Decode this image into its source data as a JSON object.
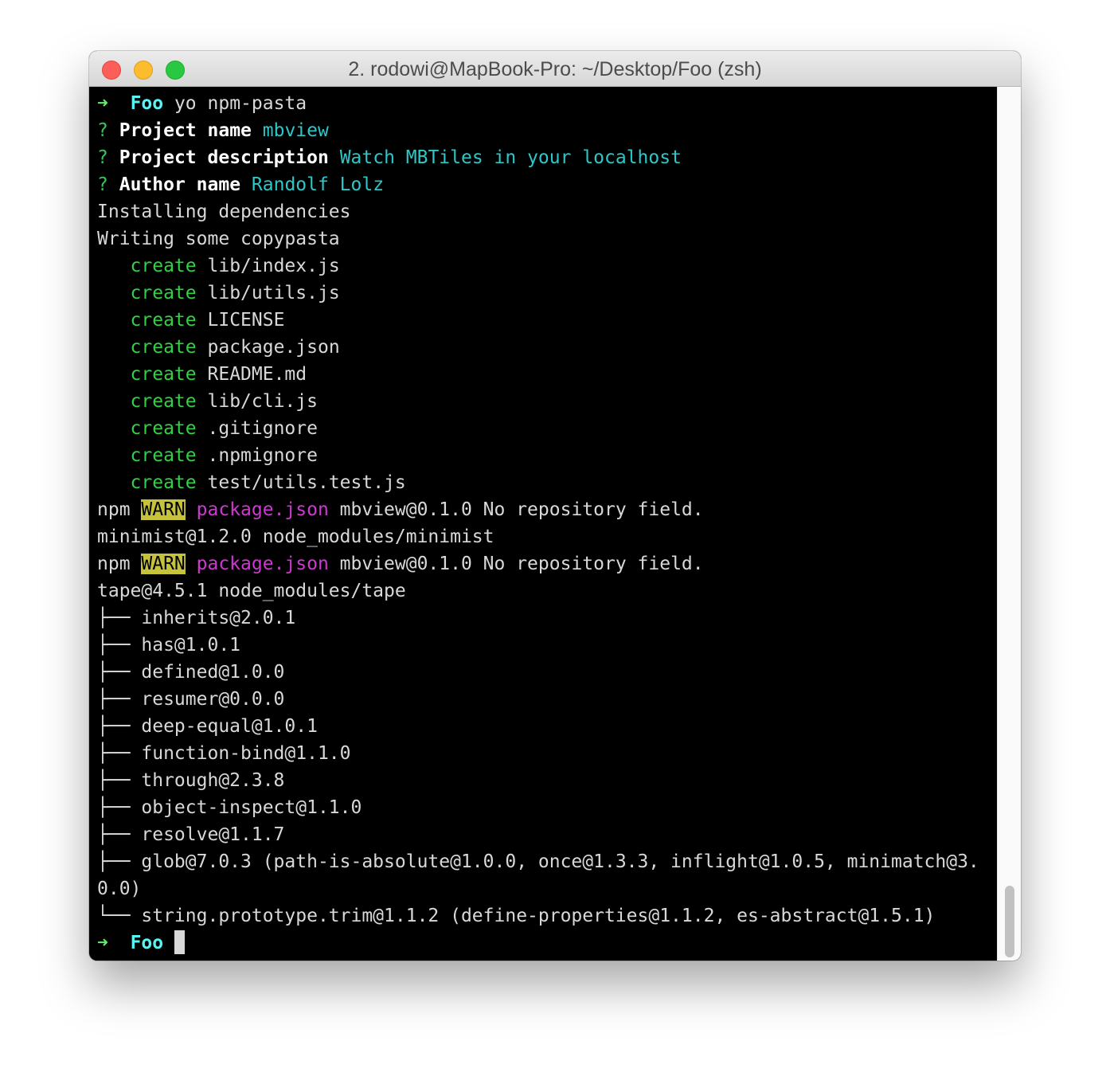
{
  "window": {
    "title": "2. rodowi@MapBook-Pro: ~/Desktop/Foo (zsh)",
    "controls": [
      "close",
      "minimize",
      "zoom"
    ]
  },
  "colors": {
    "prompt_arrow": "#5ef06a",
    "prompt_dir": "#58f4f4",
    "question_mark": "#33c55b",
    "answer": "#2dc7c9",
    "create": "#30d144",
    "warn_bg": "#c6c33b",
    "package_json": "#cf38d0",
    "text": "#d8d8d8",
    "background": "#000000"
  },
  "terminal": {
    "prompt": {
      "arrow": "➜",
      "dir": "Foo",
      "command": " yo npm-pasta"
    },
    "questions": [
      {
        "mark": "?",
        "label": "Project name",
        "answer": "mbview"
      },
      {
        "mark": "?",
        "label": "Project description",
        "answer": "Watch MBTiles in your localhost"
      },
      {
        "mark": "?",
        "label": "Author name",
        "answer": "Randolf Lolz"
      }
    ],
    "status_lines": [
      "Installing dependencies",
      "Writing some copypasta"
    ],
    "create_label": "create",
    "created_files": [
      "lib/index.js",
      "lib/utils.js",
      "LICENSE",
      "package.json",
      "README.md",
      "lib/cli.js",
      ".gitignore",
      ".npmignore",
      "test/utils.test.js"
    ],
    "npm_warn": {
      "prefix": "npm ",
      "warn": "WARN",
      "pkg": "package.json",
      "message": " mbview@0.1.0 No repository field."
    },
    "minimist_line": "minimist@1.2.0 node_modules/minimist",
    "tape_line": "tape@4.5.1 node_modules/tape",
    "tree": [
      "├── inherits@2.0.1",
      "├── has@1.0.1",
      "├── defined@1.0.0",
      "├── resumer@0.0.0",
      "├── deep-equal@1.0.1",
      "├── function-bind@1.1.0",
      "├── through@2.3.8",
      "├── object-inspect@1.1.0",
      "├── resolve@1.1.7",
      "├── glob@7.0.3 (path-is-absolute@1.0.0, once@1.3.3, inflight@1.0.5, minimatch@3.",
      "0.0)",
      "└── string.prototype.trim@1.1.2 (define-properties@1.1.2, es-abstract@1.5.1)"
    ],
    "final_prompt": {
      "arrow": "➜",
      "dir": "Foo"
    }
  }
}
